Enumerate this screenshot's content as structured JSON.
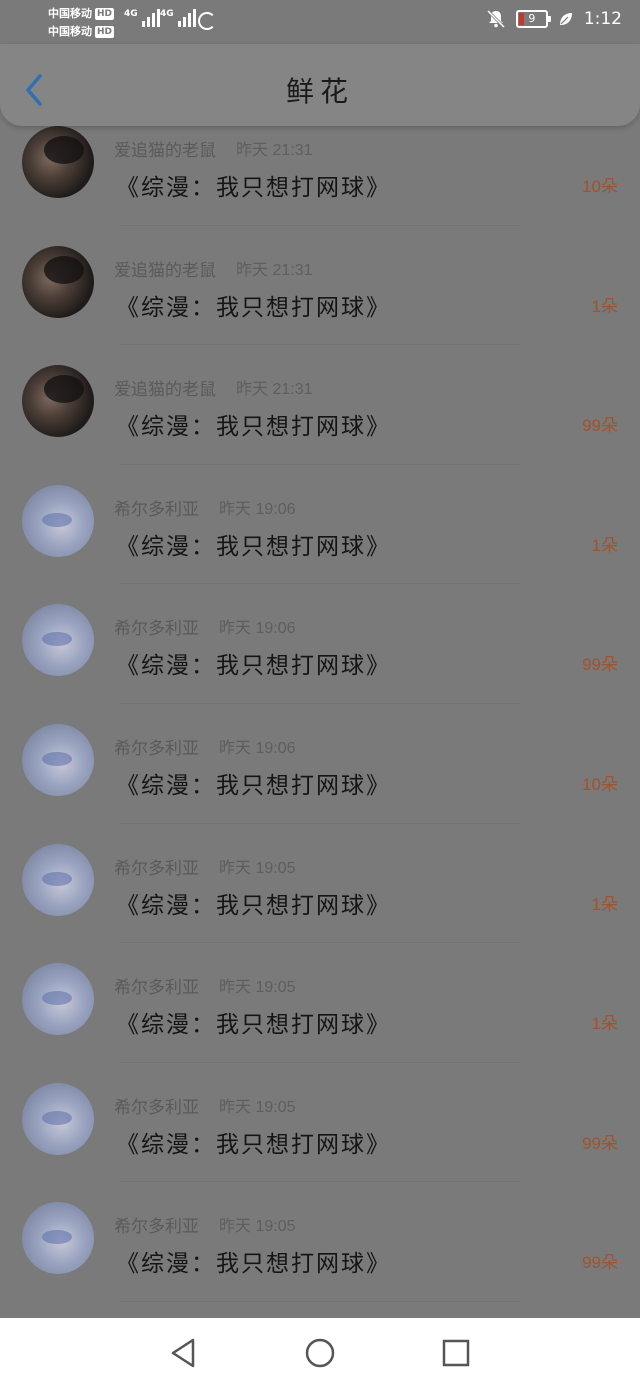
{
  "status_bar": {
    "carrier1": "中国移动",
    "carrier2": "中国移动",
    "hd": "HD",
    "network1": "4G",
    "network2": "4G",
    "battery": "9",
    "time": "1:12"
  },
  "header": {
    "title": "鲜花"
  },
  "gifts": [
    {
      "user": "爱追猫的老鼠",
      "time": "昨天 21:31",
      "book": "《综漫：我只想打网球》",
      "count": "10朵",
      "avatar": "dark"
    },
    {
      "user": "爱追猫的老鼠",
      "time": "昨天 21:31",
      "book": "《综漫：我只想打网球》",
      "count": "1朵",
      "avatar": "dark"
    },
    {
      "user": "爱追猫的老鼠",
      "time": "昨天 21:31",
      "book": "《综漫：我只想打网球》",
      "count": "99朵",
      "avatar": "dark"
    },
    {
      "user": "希尔多利亚",
      "time": "昨天 19:06",
      "book": "《综漫：我只想打网球》",
      "count": "1朵",
      "avatar": "light"
    },
    {
      "user": "希尔多利亚",
      "time": "昨天 19:06",
      "book": "《综漫：我只想打网球》",
      "count": "99朵",
      "avatar": "light"
    },
    {
      "user": "希尔多利亚",
      "time": "昨天 19:06",
      "book": "《综漫：我只想打网球》",
      "count": "10朵",
      "avatar": "light"
    },
    {
      "user": "希尔多利亚",
      "time": "昨天 19:05",
      "book": "《综漫：我只想打网球》",
      "count": "1朵",
      "avatar": "light"
    },
    {
      "user": "希尔多利亚",
      "time": "昨天 19:05",
      "book": "《综漫：我只想打网球》",
      "count": "1朵",
      "avatar": "light"
    },
    {
      "user": "希尔多利亚",
      "time": "昨天 19:05",
      "book": "《综漫：我只想打网球》",
      "count": "99朵",
      "avatar": "light"
    },
    {
      "user": "希尔多利亚",
      "time": "昨天 19:05",
      "book": "《综漫：我只想打网球》",
      "count": "99朵",
      "avatar": "light"
    }
  ],
  "colors": {
    "overlay": "#7a7a7a",
    "count": "#a0532c",
    "back_arrow": "#2f6fb2"
  }
}
